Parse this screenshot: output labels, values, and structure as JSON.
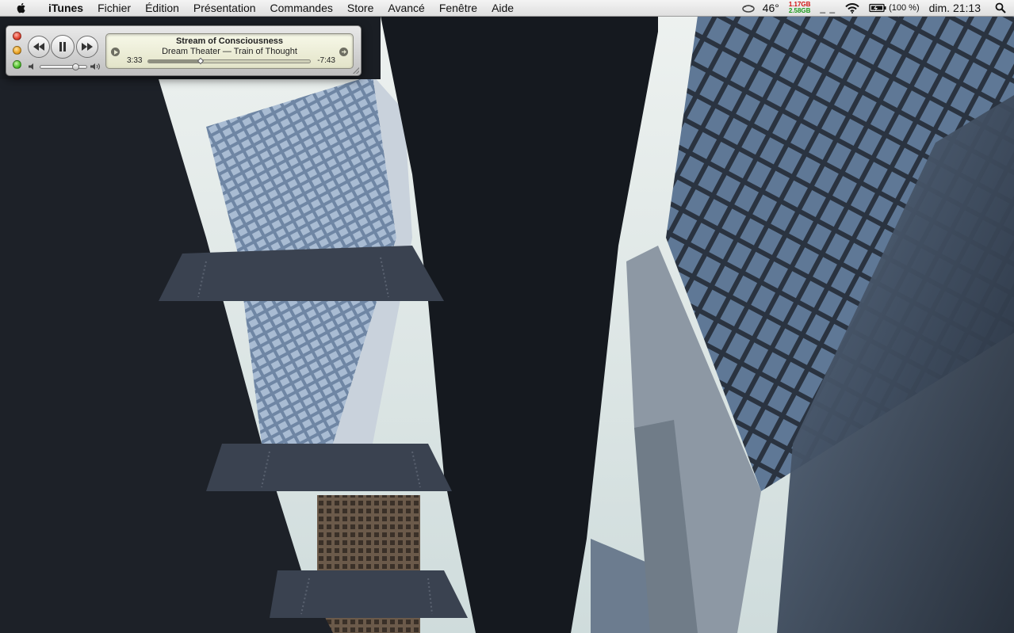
{
  "menubar": {
    "apple_icon": "apple-icon",
    "items": [
      {
        "label": "iTunes"
      },
      {
        "label": "Fichier"
      },
      {
        "label": "Édition"
      },
      {
        "label": "Présentation"
      },
      {
        "label": "Commandes"
      },
      {
        "label": "Store"
      },
      {
        "label": "Avancé"
      },
      {
        "label": "Fenêtre"
      },
      {
        "label": "Aide"
      }
    ],
    "status": {
      "temperature_icon": "weather-icon",
      "temperature": "46°",
      "memory_used": "1.17GB",
      "memory_free": "2.58GB",
      "memory_used_color": "#d01010",
      "memory_free_color": "#1a9a1a",
      "cpu_bars": "_ _",
      "wifi_icon": "wifi-icon",
      "battery_icon": "battery-icon",
      "battery_text": "(100 %)",
      "clock": "dim. 21:13",
      "spotlight_icon": "search-icon"
    }
  },
  "player": {
    "song_title": "Stream of Consciousness",
    "artist_album": "Dream Theater — Train of Thought",
    "elapsed": "3:33",
    "remaining": "-7:43",
    "progress": 0.32,
    "volume": 0.78,
    "controls": {
      "previous_icon": "rewind-icon",
      "pause_icon": "pause-icon",
      "next_icon": "fast-forward-icon"
    }
  }
}
